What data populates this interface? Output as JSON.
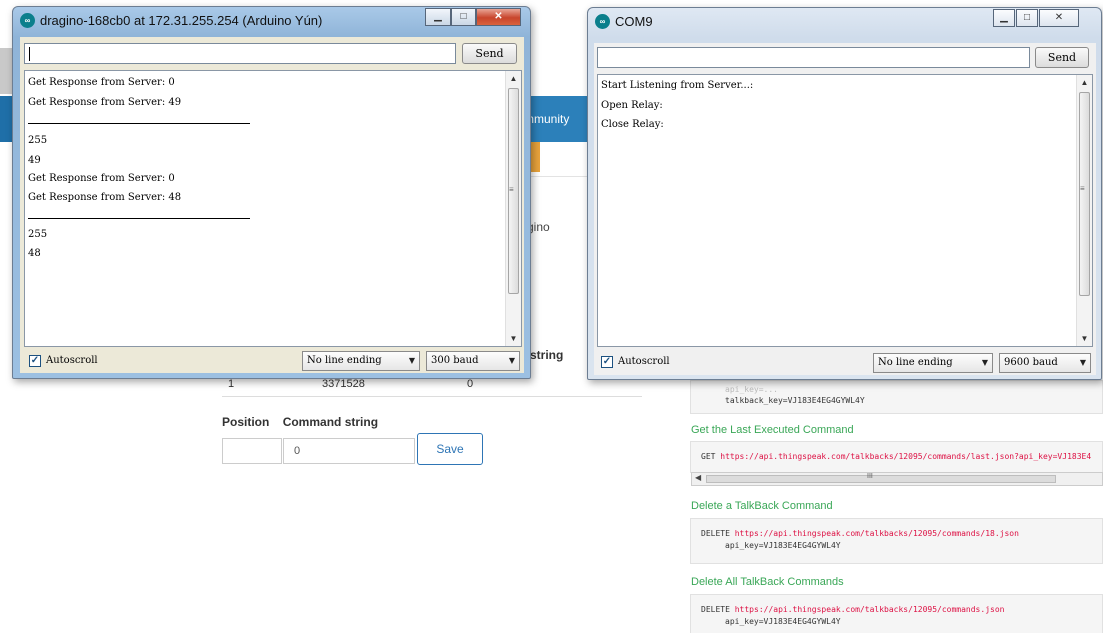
{
  "background_page": {
    "nav_item": "mmunity",
    "fragment_dragino": "gino",
    "fragment_string": "string",
    "table_row": [
      "1",
      "3371528",
      "0"
    ],
    "form": {
      "position_label": "Position",
      "command_label": "Command string",
      "command_value": "0",
      "save_label": "Save"
    },
    "docs": {
      "partial_api_key_line": "api_key=...",
      "talkback_key_line": "talkback_key=VJ183E4EG4GYWL4Y",
      "section1_title": "Get the Last Executed Command",
      "section1_method": "GET",
      "section1_url": "https://api.thingspeak.com/talkbacks/12095/commands/last.json?api_key=VJ183E4",
      "section1_scroll_mark": "III",
      "section2_title": "Delete a TalkBack Command",
      "section2_method": "DELETE",
      "section2_url": "https://api.thingspeak.com/talkbacks/12095/commands/18.json",
      "section2_param": "api_key=VJ183E4EG4GYWL4Y",
      "section3_title": "Delete All TalkBack Commands",
      "section3_method": "DELETE",
      "section3_url": "https://api.thingspeak.com/talkbacks/12095/commands.json",
      "section3_param": "api_key=VJ183E4EG4GYWL4Y"
    }
  },
  "window_left": {
    "title": "dragino-168cb0 at 172.31.255.254 (Arduino Yún)",
    "send_label": "Send",
    "input_value": "",
    "output_lines": [
      "Get Response from Server: 0",
      "Get Response from Server: 49",
      "255",
      "49",
      "Get Response from Server: 0",
      "Get Response from Server: 48",
      "255",
      "48"
    ],
    "autoscroll_label": "Autoscroll",
    "autoscroll_checked": true,
    "line_ending": "No line ending",
    "baud": "300 baud"
  },
  "window_right": {
    "title": "COM9",
    "send_label": "Send",
    "input_value": "",
    "output_lines": [
      "Start Listening from Server...:",
      "Open Relay:",
      "Close Relay:"
    ],
    "autoscroll_label": "Autoscroll",
    "autoscroll_checked": true,
    "line_ending": "No line ending",
    "baud": "9600 baud"
  },
  "icons": {
    "app_icon": "arduino-logo-icon",
    "minimize": "minimize-icon",
    "maximize": "maximize-icon",
    "close": "close-icon",
    "checkbox": "checkmark-icon",
    "dropdown": "chevron-down-icon"
  },
  "colors": {
    "nav_blue": "#1f6fa8",
    "docs_heading_green": "#3aa757",
    "url_red": "#d14",
    "key_teal": "#1a9a8a",
    "close_red": "#c8452c"
  }
}
